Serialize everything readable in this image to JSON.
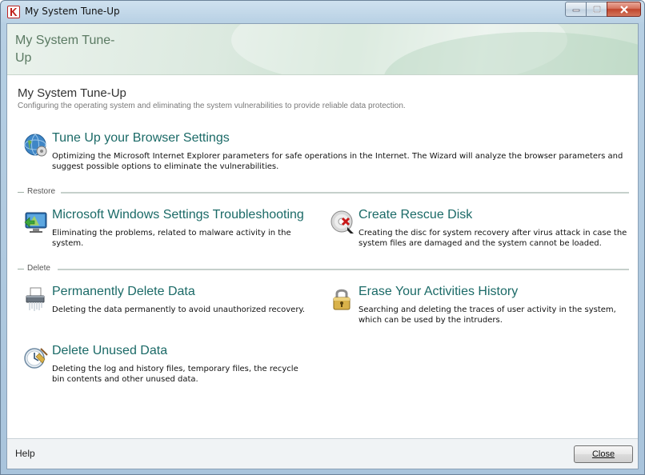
{
  "window": {
    "title": "My System Tune-Up"
  },
  "banner": {
    "title": "My System Tune-Up"
  },
  "page": {
    "title": "My System Tune-Up",
    "subtitle": "Configuring the operating system and eliminating the system vulnerabilities to provide reliable data protection."
  },
  "items": {
    "browser": {
      "title": "Tune Up your Browser Settings",
      "description": "Optimizing the Microsoft Internet Explorer parameters for safe operations in the Internet. The Wizard will analyze the browser parameters and suggest possible options to eliminate the vulnerabilities.",
      "icon": "browser-tuneup-icon"
    },
    "troubleshooting": {
      "title": "Microsoft Windows Settings Troubleshooting",
      "description": "Eliminating the problems, related to malware activity in the system.",
      "icon": "windows-troubleshooting-icon"
    },
    "rescue": {
      "title": "Create Rescue Disk",
      "description": "Creating the disc for system recovery after virus attack in case the system files are damaged and the system cannot be loaded.",
      "icon": "rescue-disk-icon"
    },
    "delete_data": {
      "title": "Permanently Delete Data",
      "description": "Deleting the data permanently to avoid unauthorized recovery.",
      "icon": "shredder-icon"
    },
    "erase_history": {
      "title": "Erase Your Activities History",
      "description": "Searching and deleting the traces of user activity in the system, which can be used by the intruders.",
      "icon": "padlock-icon"
    },
    "delete_unused": {
      "title": "Delete Unused Data",
      "description": "Deleting the log and history files, temporary files, the recycle bin contents and other unused data.",
      "icon": "clock-broom-icon"
    }
  },
  "sections": {
    "restore": "Restore",
    "delete": "Delete"
  },
  "footer": {
    "help": "Help",
    "close": "Close"
  },
  "colors": {
    "link": "#1b6a67",
    "banner_text": "#5b7a63"
  }
}
